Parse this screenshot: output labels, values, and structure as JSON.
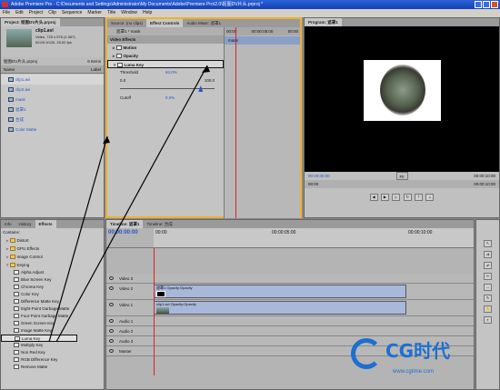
{
  "window": {
    "title": "Adobe Premiere Pro - C:\\Documents and Settings\\Administrator\\My Documents\\Adobe\\Premiere Pro\\2.0\\抠图DV片头.prproj *"
  },
  "menu": [
    "File",
    "Edit",
    "Project",
    "Clip",
    "Sequence",
    "Marker",
    "Title",
    "Window",
    "Help"
  ],
  "project": {
    "tab": "Project: 抠图DV片头.prproj",
    "clip_name": "clip1.avi",
    "clip_info1": "Video, 720 x 576 (1.067)",
    "clip_info2": "00:00:10:00, 25.00 fps",
    "path": "抠图DV片头.prproj",
    "count": "6 Items",
    "col_name": "Name",
    "col_label": "Label",
    "items": [
      {
        "icon": "clip",
        "name": "clip1.avi"
      },
      {
        "icon": "clip",
        "name": "clip2.avi"
      },
      {
        "icon": "clip",
        "name": "mask"
      },
      {
        "icon": "clip",
        "name": "遮罩1"
      },
      {
        "icon": "clip",
        "name": "合成"
      },
      {
        "icon": "clip",
        "name": "Color Matte"
      }
    ]
  },
  "effect_controls": {
    "tabs": [
      "Source: (no clips)",
      "Effect Controls",
      "Audio Mixer: 遮罩1"
    ],
    "clip_header": "遮罩1 * mask",
    "ruler_start": "00:00",
    "ruler_end": "00:00:05:00",
    "ruler_end2": "00:00",
    "mask_label": "mask",
    "section": "Video Effects",
    "motion": "Motion",
    "opacity": "Opacity",
    "luma_key": "Luma Key",
    "threshold_label": "Threshold",
    "threshold_value": "84.0%",
    "range_min": "0.0",
    "range_max": "100.0",
    "cutoff_label": "Cutoff",
    "cutoff_value": "0.0%"
  },
  "program": {
    "tab": "Program: 遮罩1",
    "timecode": "00:00:00:00",
    "fit": "Fit",
    "duration": "00:00:10:00",
    "ruler_left": "00:00",
    "ruler_right": "00:00:10:00"
  },
  "effects_panel": {
    "tabs": [
      "Info",
      "History",
      "Effects"
    ],
    "search": "Contains:",
    "folders": [
      "Distort",
      "GPU Effects",
      "Image Control",
      "Keying"
    ],
    "items": [
      "Alpha Adjust",
      "Blue Screen Key",
      "Chroma Key",
      "Color Key",
      "Difference Matte Key",
      "Eight-Point Garbage Matte",
      "Four-Point Garbage Matte",
      "Green Screen Key",
      "Image Matte Key",
      "Luma Key",
      "Multiply Key",
      "Non Red Key",
      "RGB Difference Key",
      "Remove Matte"
    ]
  },
  "timeline": {
    "tabs": [
      "Timeline: 遮罩1",
      "Timeline: 合成"
    ],
    "timecode": "00:00:00:00",
    "ruler_marks": [
      "00:00",
      "00:00:05:00",
      "00:00:10:00"
    ],
    "tracks": [
      {
        "name": "Video 3",
        "clip": ""
      },
      {
        "name": "Video 2",
        "clip": "遮罩1 Opacity:Opacity"
      },
      {
        "name": "Video 1",
        "clip": "clip1.avi Opacity:Opacity"
      },
      {
        "name": "Audio 1",
        "clip": ""
      },
      {
        "name": "Audio 2",
        "clip": ""
      },
      {
        "name": "Audio 3",
        "clip": ""
      },
      {
        "name": "Master",
        "clip": ""
      }
    ]
  },
  "watermark": {
    "brand": "CG时代",
    "url": "www.cgtime.com"
  }
}
